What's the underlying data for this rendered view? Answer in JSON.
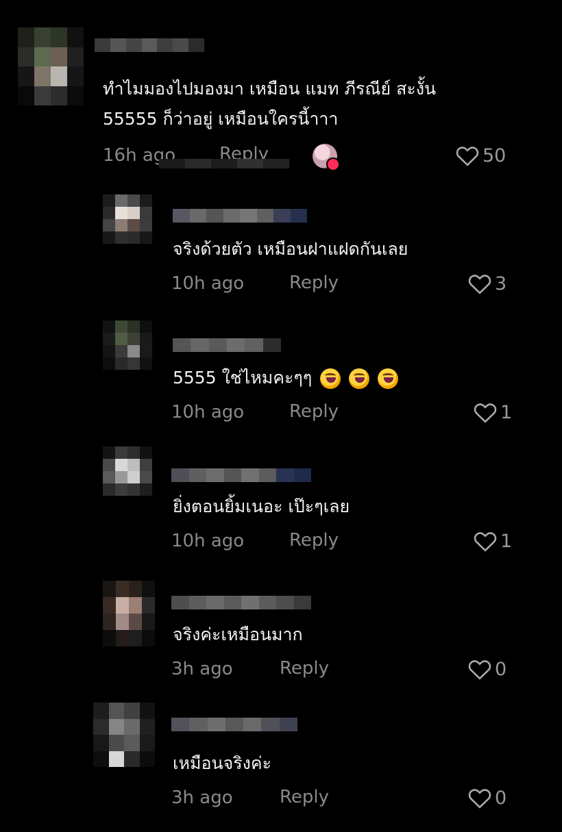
{
  "comments": [
    {
      "text_lines": [
        "ทำไมมองไปมองมา เหมือน แมท ภีรณีย์ สะงั้น",
        "55555 ก็ว่าอยู่ เหมือนใครนี้าาา"
      ],
      "time": "16h ago",
      "reply_label": "Reply",
      "likes": "50",
      "liked_by_creator": true
    },
    {
      "text_lines": [
        "จริงด้วยตัว เหมือนฝาแฝดกันเลย"
      ],
      "time": "10h ago",
      "reply_label": "Reply",
      "likes": "3"
    },
    {
      "text_lines": [
        "5555 ใช่ไหมคะๆๆ"
      ],
      "emoji": [
        "rofl",
        "rofl",
        "rofl"
      ],
      "time": "10h ago",
      "reply_label": "Reply",
      "likes": "1"
    },
    {
      "text_lines": [
        "ยิ่งตอนยิ้มเนอะ เป๊ะๆเลย"
      ],
      "time": "10h ago",
      "reply_label": "Reply",
      "likes": "1"
    },
    {
      "text_lines": [
        "จริงค่ะเหมือนมาก"
      ],
      "time": "3h ago",
      "reply_label": "Reply",
      "likes": "0"
    },
    {
      "text_lines": [
        "เหมือนจริงค่ะ"
      ],
      "time": "3h ago",
      "reply_label": "Reply",
      "likes": "0"
    }
  ],
  "colors": {
    "background": "#000000",
    "text": "#f2f2f2",
    "muted": "#8a8a8a",
    "badge": "#fe2c55"
  },
  "icons": {
    "like": "heart-outline-icon",
    "creator_like": "creator-liked-badge-icon"
  }
}
